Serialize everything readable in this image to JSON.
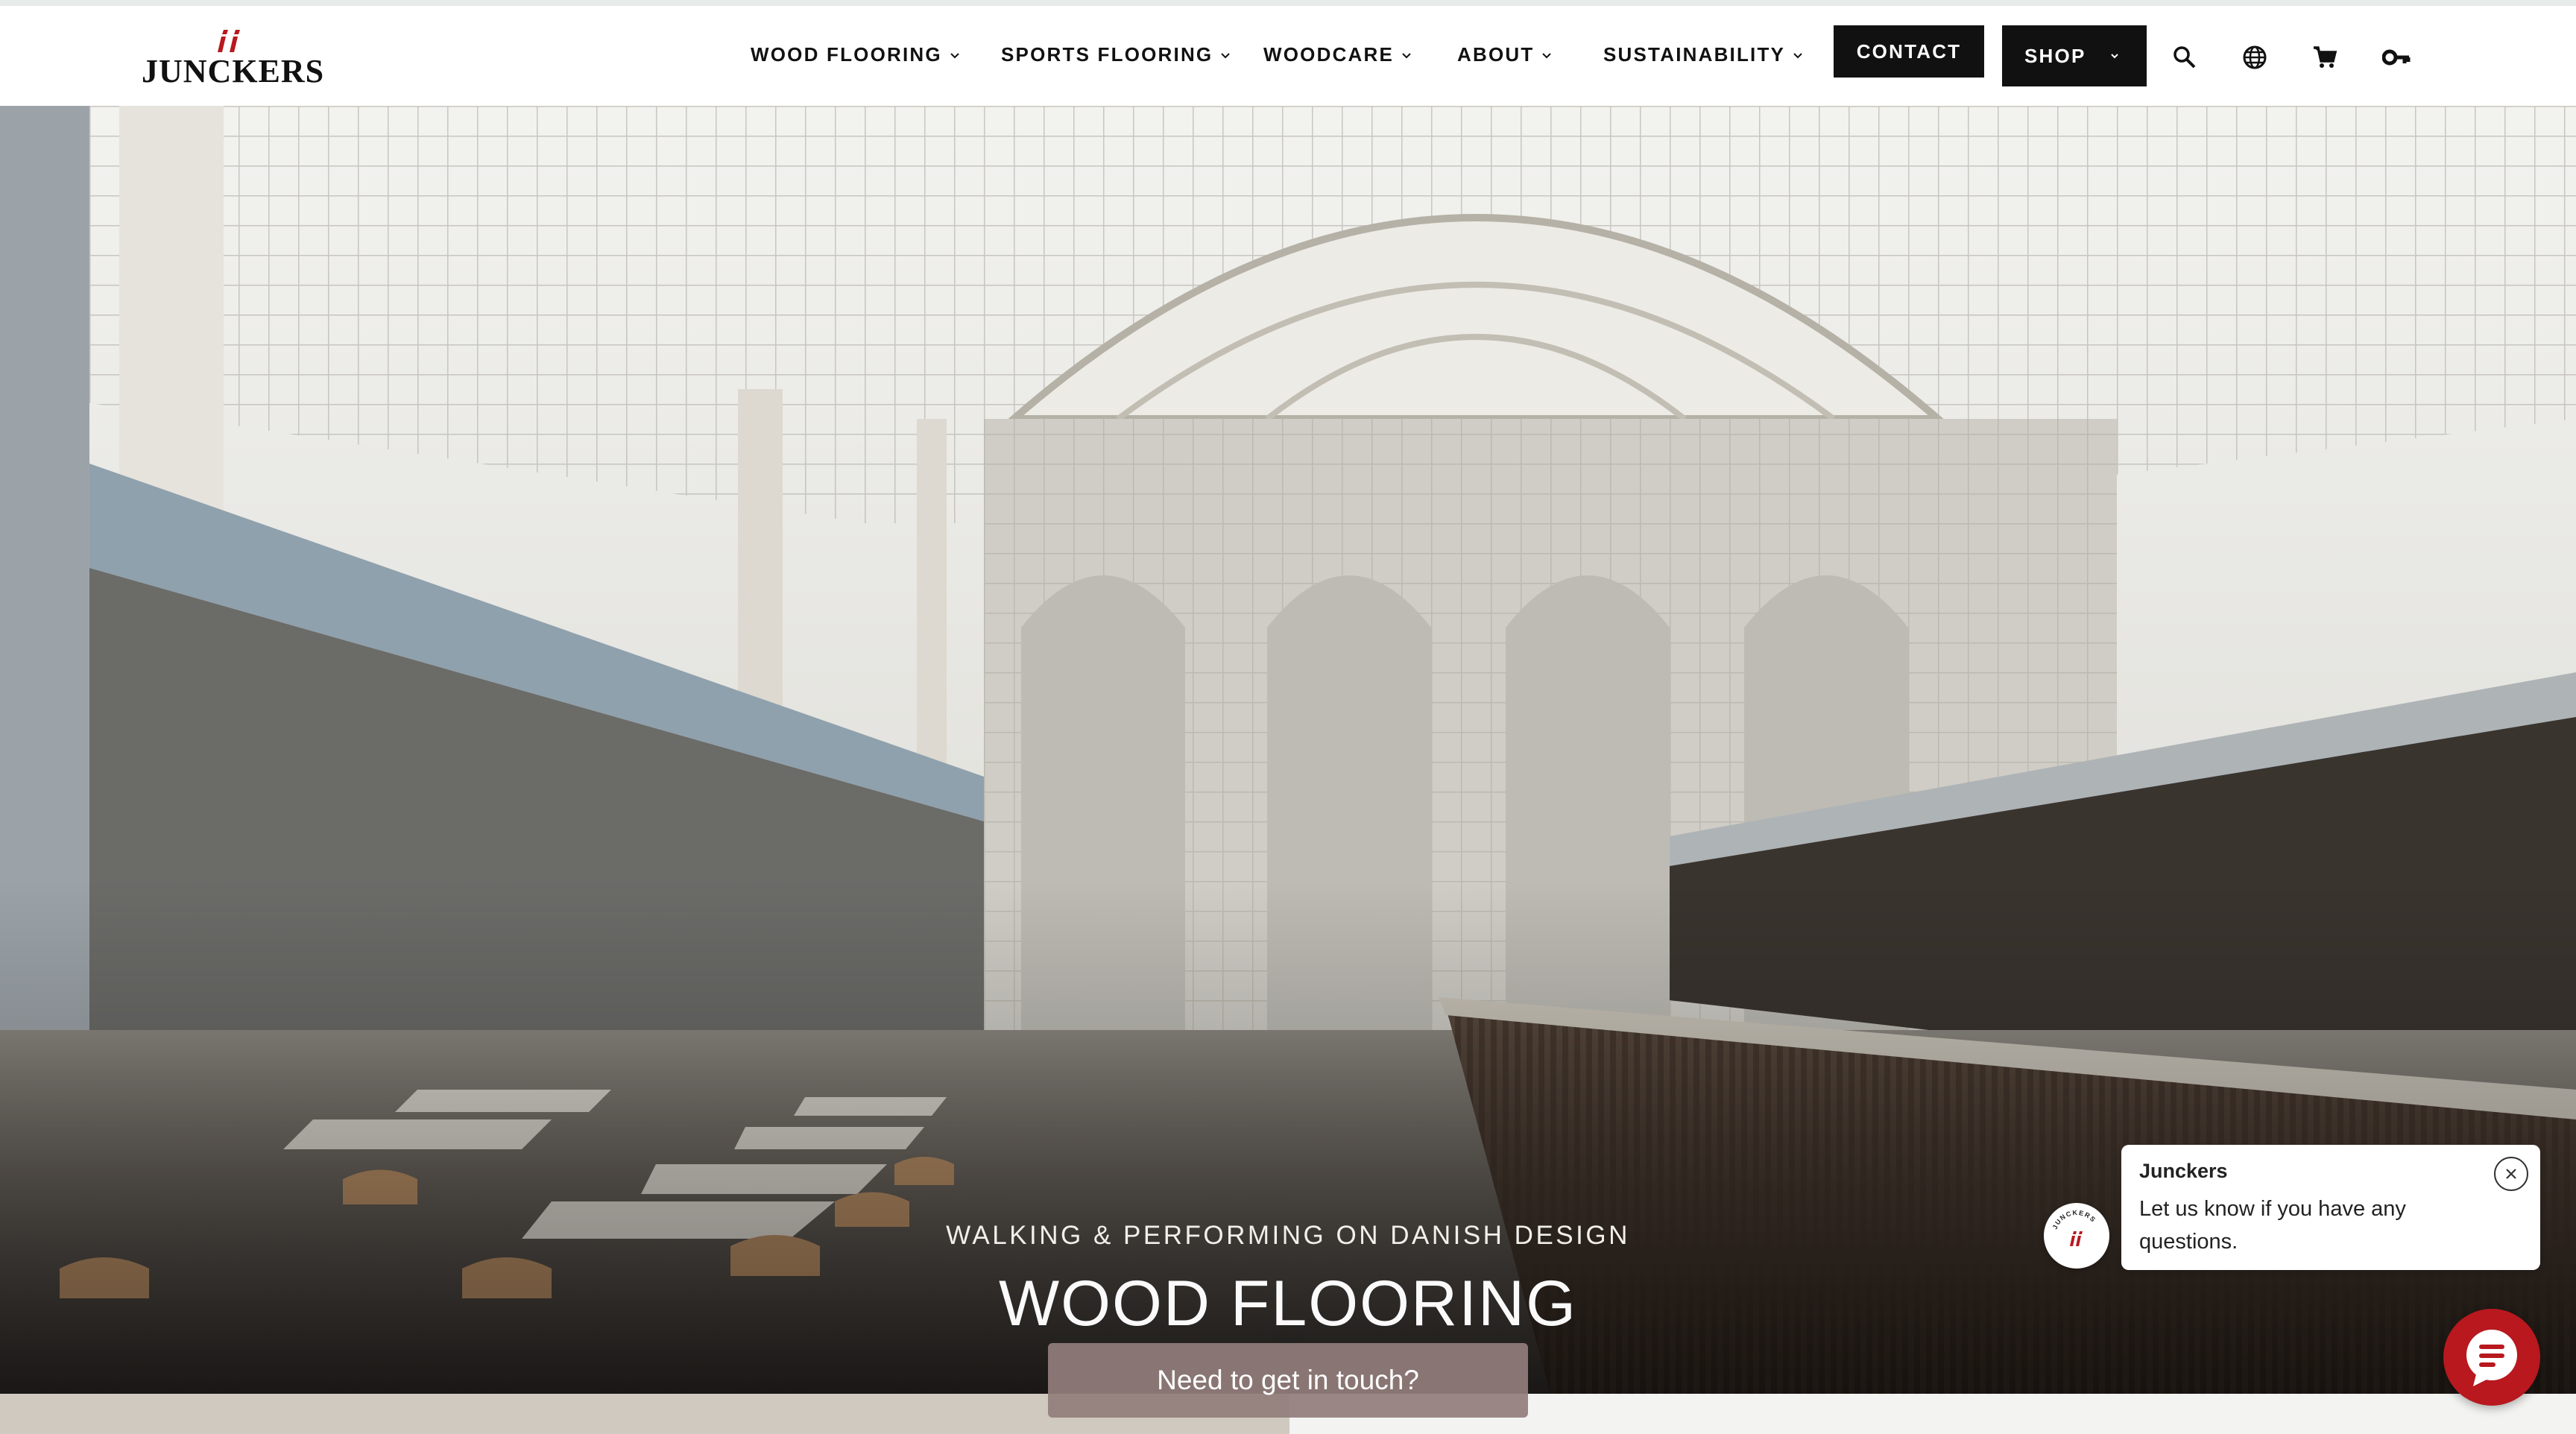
{
  "brand": {
    "name": "JUNCKERS",
    "accent": "#b8181e",
    "dark": "#111111"
  },
  "nav": {
    "items": [
      {
        "label": "WOOD FLOORING"
      },
      {
        "label": "SPORTS FLOORING"
      },
      {
        "label": "WOODCARE"
      },
      {
        "label": "ABOUT"
      },
      {
        "label": "SUSTAINABILITY"
      }
    ],
    "contact_label": "CONTACT",
    "shop_label": "SHOP",
    "icons": [
      "search-icon",
      "globe-icon",
      "cart-icon",
      "key-icon"
    ]
  },
  "hero": {
    "subtitle": "WALKING & PERFORMING ON DANISH DESIGN",
    "title": "WOOD FLOORING",
    "cta_label": "Need to get in touch?"
  },
  "chat": {
    "sender": "Junckers",
    "message": "Let us know if you have any questions.",
    "avatar_text": "JUNCKERS"
  }
}
